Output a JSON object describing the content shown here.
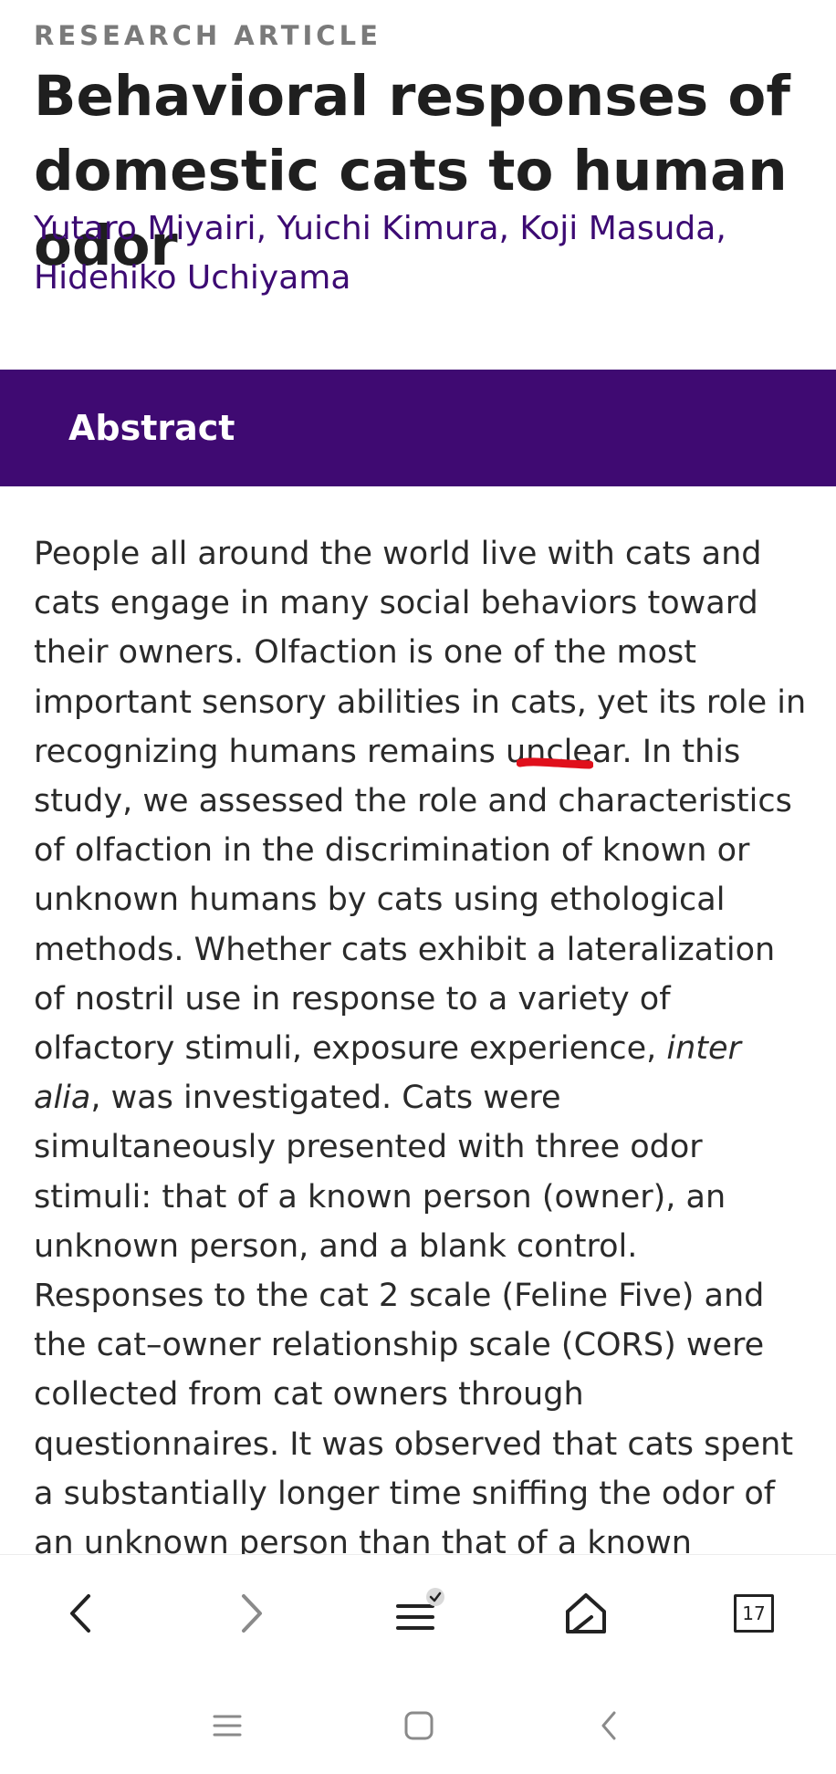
{
  "article": {
    "type": "RESEARCH ARTICLE",
    "title": "Behavioral responses of domestic cats to human odor",
    "authors": "Yutaro Miyairi, Yuichi Kimura, Koji Masuda, Hidehiko Uchiyama"
  },
  "abstract": {
    "heading": "Abstract",
    "text_part1": "People all around the world live with cats and cats engage in many social behaviors toward their owners. Olfaction is one of the most important sensory abilities in cats, yet its role in recognizing humans remains unclear. In this study, we assessed the role and characteristics of olfaction in the discrimination of known or unknown humans by cats using ethological methods. Whether cats exhibit a lateralization of nostril use in response to a variety of olfactory stimuli, exposure experience, ",
    "text_italic": "inter alia",
    "text_part2": ", was investigated. Cats were simultaneously presented with three odor stimuli: that of a known person (owner), an unknown person, and a blank control. Responses to the cat 2 scale (Feline Five) and the cat–owner relationship scale (CORS) were collected from cat owners through questionnaires. It was observed that cats spent a substantially longer time sniffing the odor of an unknown person than that of a known person, indicating the use of their sense"
  },
  "toolbar": {
    "tabs_count": "17"
  },
  "icons": {
    "back": "chevron-left-icon",
    "forward": "chevron-right-icon",
    "menu": "menu-icon",
    "menu_badge": "check-badge-icon",
    "home": "home-icon",
    "tabs": "tabs-icon",
    "nav_recents": "recents-icon",
    "nav_home": "nav-home-icon",
    "nav_back": "nav-back-icon"
  },
  "colors": {
    "brand_purple": "#3f0a72",
    "author_link": "#3c0a73",
    "ink_mark": "#e0101c"
  }
}
